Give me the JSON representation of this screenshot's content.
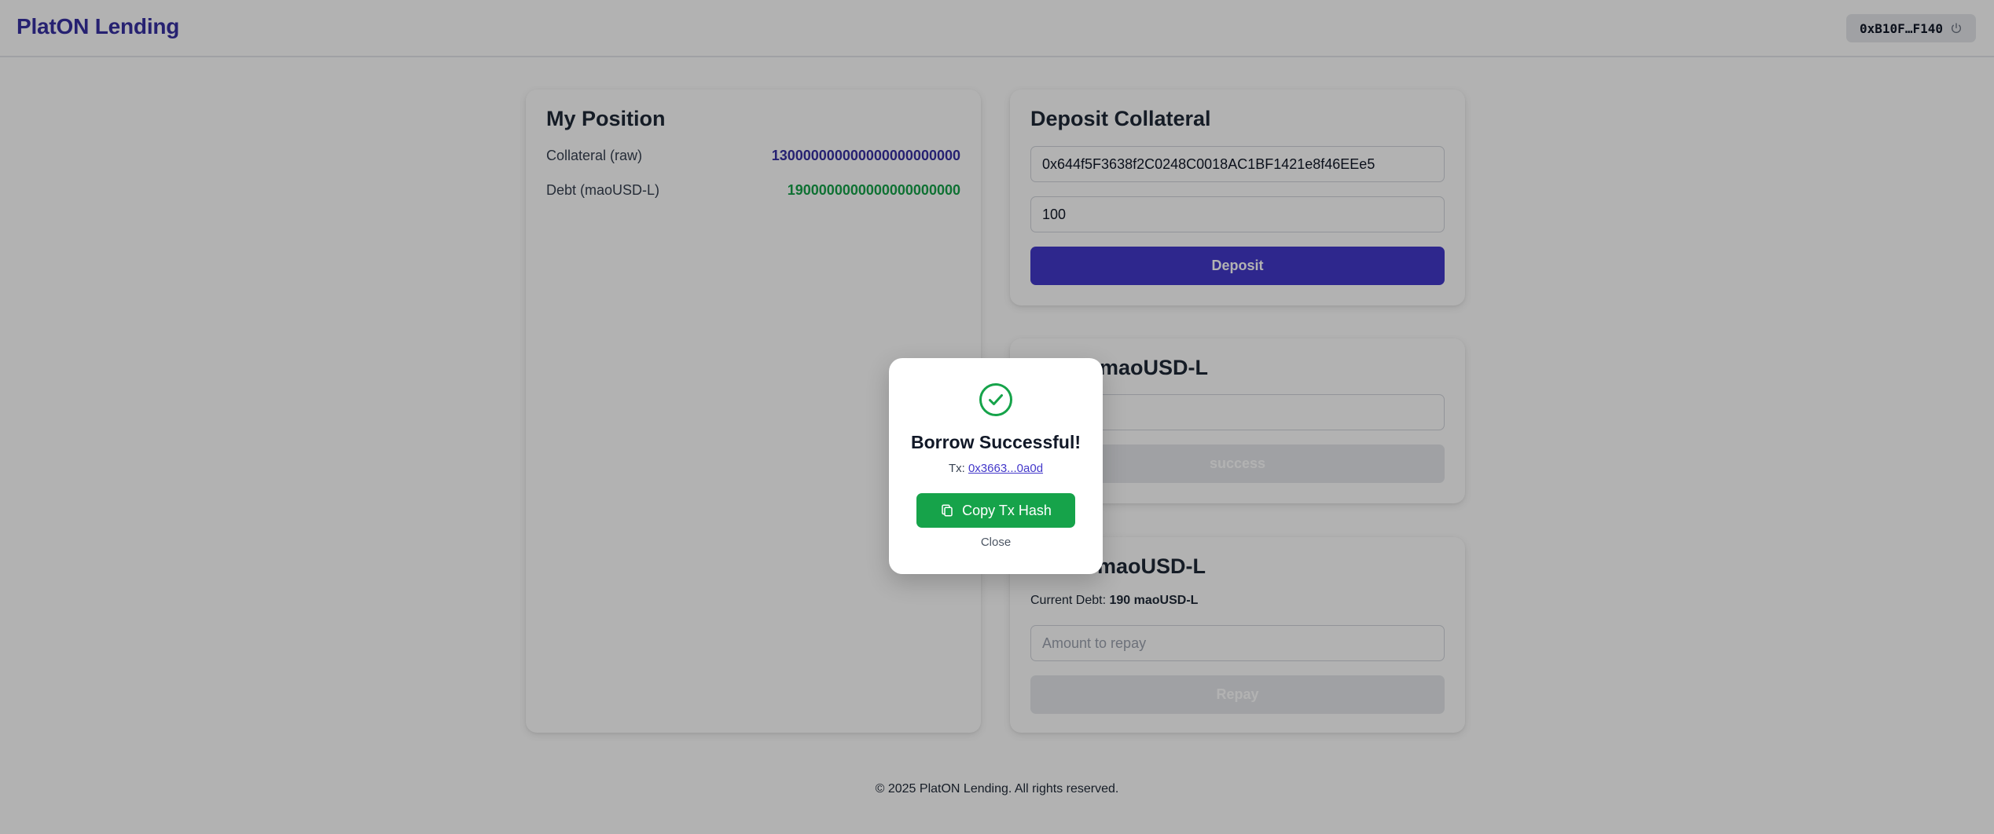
{
  "header": {
    "brand": "PlatON Lending",
    "wallet_address": "0xB10F…F140",
    "power_icon": "power-icon"
  },
  "position": {
    "title": "My Position",
    "collateral_label": "Collateral (raw)",
    "collateral_value": "130000000000000000000000",
    "debt_label": "Debt (maoUSD-L)",
    "debt_value": "1900000000000000000000"
  },
  "deposit": {
    "title": "Deposit Collateral",
    "token_address_value": "0x644f5F3638f2C0248C0018AC1BF1421e8f46EEe5",
    "amount_value": "100",
    "button_label": "Deposit"
  },
  "borrow": {
    "title_visible": "maoUSD-L",
    "button_label": "success"
  },
  "repay": {
    "title_visible": "maoUSD-L",
    "debt_prefix": "Current Debt:",
    "debt_value": "190 maoUSD-L",
    "amount_placeholder": "Amount to repay",
    "button_label": "Repay"
  },
  "footer": {
    "text": "© 2025 PlatON Lending. All rights reserved."
  },
  "modal": {
    "title": "Borrow Successful!",
    "tx_prefix": "Tx:",
    "tx_hash_short": "0x3663...0a0d",
    "copy_button_label": "Copy Tx Hash",
    "close_label": "Close",
    "icons": {
      "success": "check-circle-icon",
      "copy": "copy-icon"
    }
  },
  "colors": {
    "brand": "#3730a3",
    "primary_button": "#4338ca",
    "success": "#16a34a",
    "overlay": "rgba(0,0,0,0.30)"
  }
}
